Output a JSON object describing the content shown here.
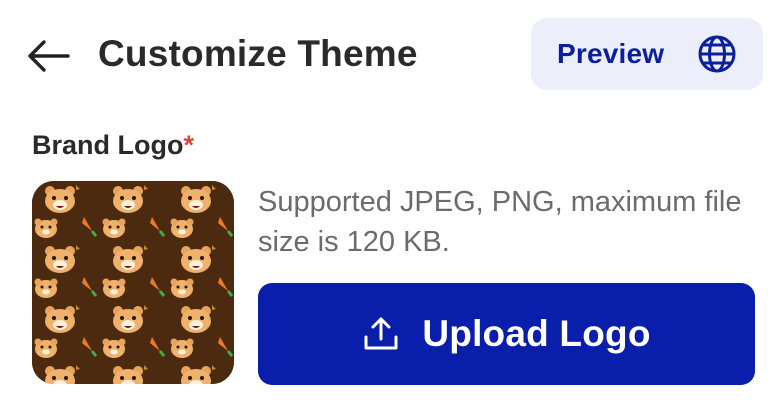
{
  "header": {
    "back_icon": "arrow-left-icon",
    "title": "Customize Theme",
    "preview": {
      "label": "Preview",
      "icon": "globe-icon"
    }
  },
  "brand_logo": {
    "label": "Brand Logo",
    "required_mark": "*",
    "hint": "Supported JPEG, PNG, maximum file size is 120 KB.",
    "upload_button": {
      "label": "Upload Logo",
      "icon": "upload-icon"
    }
  },
  "colors": {
    "primary": "#0a1eac",
    "preview_bg": "#eceef9",
    "preview_text": "#0a1f9e",
    "required": "#e0453a",
    "hint_text": "#6b6b6b"
  }
}
